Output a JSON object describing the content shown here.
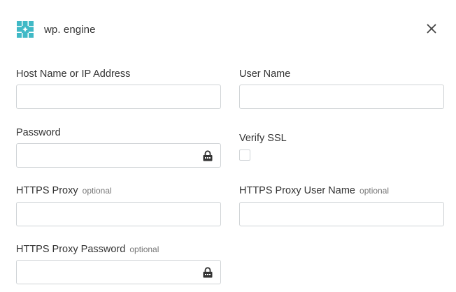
{
  "header": {
    "title": "wp. engine",
    "logo_icon": "wpengine-logo-icon",
    "close_icon": "close-icon",
    "brand_color": "#40b9c6"
  },
  "form": {
    "host": {
      "label": "Host Name or IP Address",
      "value": "",
      "placeholder": ""
    },
    "user": {
      "label": "User Name",
      "value": "",
      "placeholder": ""
    },
    "password": {
      "label": "Password",
      "value": "",
      "placeholder": "",
      "icon": "lock-icon"
    },
    "verify_ssl": {
      "label": "Verify SSL",
      "checked": false
    },
    "https_proxy": {
      "label": "HTTPS Proxy",
      "optional": "optional",
      "value": "",
      "placeholder": ""
    },
    "https_proxy_user": {
      "label": "HTTPS Proxy User Name",
      "optional": "optional",
      "value": "",
      "placeholder": ""
    },
    "https_proxy_password": {
      "label": "HTTPS Proxy Password",
      "optional": "optional",
      "value": "",
      "placeholder": "",
      "icon": "lock-icon"
    }
  }
}
